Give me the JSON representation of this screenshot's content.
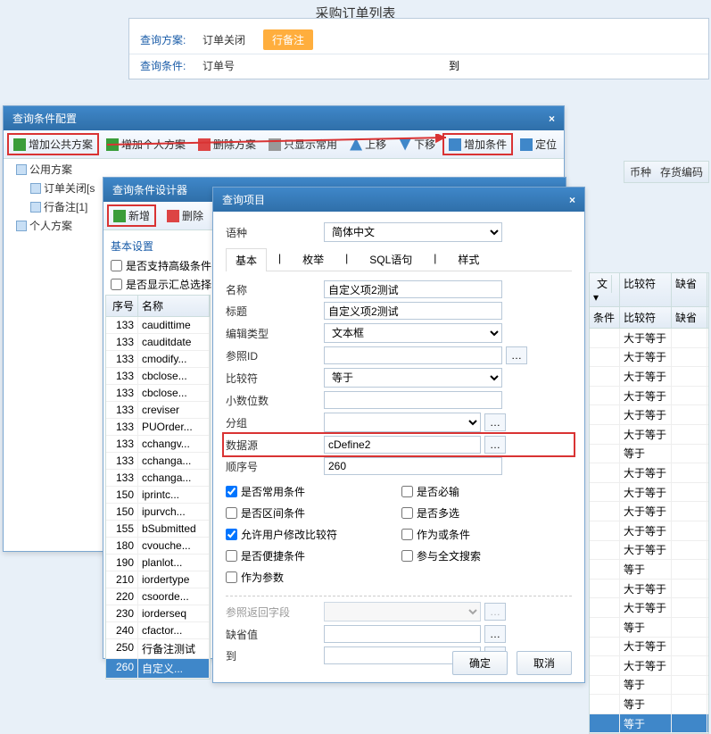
{
  "page_title": "采购订单列表",
  "panel1": {
    "row1_label": "查询方案:",
    "row1_value": "订单关闭",
    "row1_button": "行备注",
    "row2_label": "查询条件:",
    "row2_value": "订单号",
    "row2_to": "到"
  },
  "win_config": {
    "title": "查询条件配置",
    "tb": {
      "add_public": "增加公共方案",
      "add_private": "增加个人方案",
      "delete": "删除方案",
      "common_only": "只显示常用",
      "move_up": "上移",
      "move_down": "下移",
      "add_cond": "增加条件",
      "locate": "定位"
    }
  },
  "tree": {
    "root1": "公用方案",
    "c1": "订单关闭[s",
    "c2": "行备注[1]",
    "root2": "个人方案"
  },
  "bglist_hdr": {
    "c1": "币种",
    "c2": "存货编码"
  },
  "win_designer": {
    "title": "查询条件设计器",
    "tb_new": "新增",
    "tb_del": "删除",
    "group": "基本设置",
    "chk1": "是否支持高级条件",
    "chk2": "是否显示汇总选择"
  },
  "lefttable": {
    "h1": "序号",
    "h2": "名称",
    "rows": [
      {
        "n": "133",
        "m": "caudittime"
      },
      {
        "n": "133",
        "m": "cauditdate"
      },
      {
        "n": "133",
        "m": "cmodify..."
      },
      {
        "n": "133",
        "m": "cbclose..."
      },
      {
        "n": "133",
        "m": "cbclose..."
      },
      {
        "n": "133",
        "m": "creviser"
      },
      {
        "n": "133",
        "m": "PUOrder..."
      },
      {
        "n": "133",
        "m": "cchangv..."
      },
      {
        "n": "133",
        "m": "cchanga..."
      },
      {
        "n": "133",
        "m": "cchanga..."
      },
      {
        "n": "150",
        "m": "iprintc..."
      },
      {
        "n": "150",
        "m": "ipurvch..."
      },
      {
        "n": "155",
        "m": "bSubmitted"
      },
      {
        "n": "180",
        "m": "cvouche..."
      },
      {
        "n": "190",
        "m": "planlot..."
      },
      {
        "n": "210",
        "m": "iordertype"
      },
      {
        "n": "220",
        "m": "csoorde..."
      },
      {
        "n": "230",
        "m": "iorderseq"
      },
      {
        "n": "240",
        "m": "cfactor..."
      },
      {
        "n": "250",
        "m": "行备注测试"
      },
      {
        "n": "260",
        "m": "自定义...",
        "sel": true
      }
    ]
  },
  "win_item": {
    "title": "查询项目",
    "lang_lbl": "语种",
    "lang_val": "简体中文",
    "tabs": [
      "基本",
      "枚举",
      "SQL语句",
      "样式"
    ],
    "f_name_lbl": "名称",
    "f_name_val": "自定义项2测试",
    "f_title_lbl": "标题",
    "f_title_val": "自定义项2测试",
    "f_edit_lbl": "编辑类型",
    "f_edit_val": "文本框",
    "f_refid_lbl": "参照ID",
    "f_refid_val": "",
    "f_cmp_lbl": "比较符",
    "f_cmp_val": "等于",
    "f_dec_lbl": "小数位数",
    "f_dec_val": "",
    "f_grp_lbl": "分组",
    "f_grp_val": "",
    "f_ds_lbl": "数据源",
    "f_ds_val": "cDefine2",
    "f_ord_lbl": "顺序号",
    "f_ord_val": "260",
    "chks": {
      "c1": "是否常用条件",
      "c2": "是否必输",
      "c3": "是否区间条件",
      "c4": "是否多选",
      "c5": "允许用户修改比较符",
      "c6": "作为或条件",
      "c7": "是否便捷条件",
      "c8": "参与全文搜索",
      "c9": "作为参数"
    },
    "ret_lbl": "参照返回字段",
    "def_lbl": "缺省值",
    "def_val": "",
    "to_lbl": "到",
    "to_val": "",
    "ok": "确定",
    "cancel": "取消"
  },
  "righttable": {
    "h0": "文",
    "h1": "条件",
    "h2": "比较符",
    "h3": "缺省",
    "rows": [
      "大于等于",
      "大于等于",
      "大于等于",
      "大于等于",
      "大于等于",
      "大于等于",
      "等于",
      "大于等于",
      "大于等于",
      "大于等于",
      "大于等于",
      "大于等于",
      "等于",
      "大于等于",
      "大于等于",
      "等于",
      "大于等于",
      "大于等于",
      "等于",
      "等于"
    ],
    "last": "等于"
  }
}
